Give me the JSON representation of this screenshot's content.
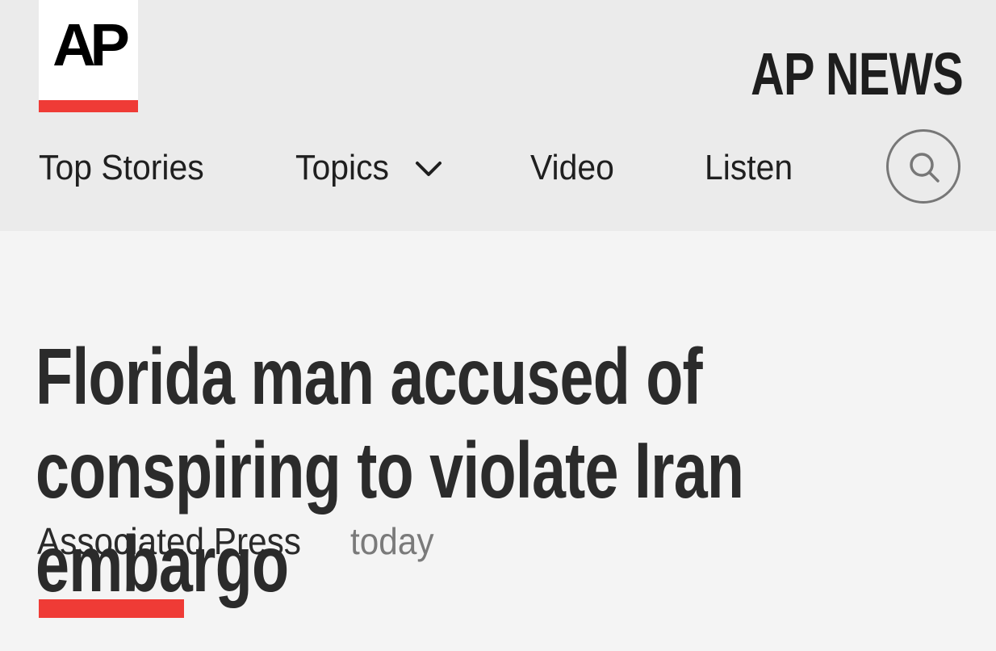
{
  "brand": {
    "logo_text": "AP",
    "masthead": "AP NEWS"
  },
  "nav": {
    "items": [
      {
        "label": "Top Stories"
      },
      {
        "label": "Topics",
        "icon": "chevron-down-icon"
      },
      {
        "label": "Video"
      },
      {
        "label": "Listen"
      }
    ],
    "search_icon": "search-icon"
  },
  "article": {
    "headline": "Florida man accused of conspiring to violate Iran embargo",
    "byline": "Associated Press",
    "timestamp": "today"
  },
  "colors": {
    "accent": "#ef3b36",
    "header_bg": "#ebebeb",
    "page_bg": "#f4f4f4",
    "text": "#2a2a2a",
    "muted_text": "#7a7a7a"
  }
}
